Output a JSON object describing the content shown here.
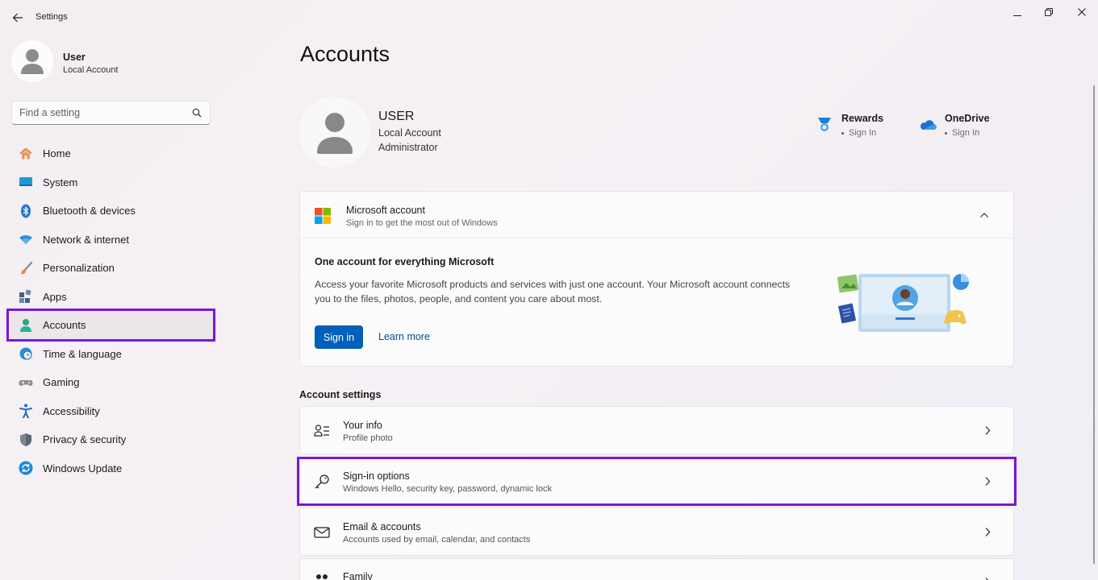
{
  "window": {
    "title": "Settings",
    "icons": {
      "back": "back-arrow-icon",
      "minimize": "minimize-icon",
      "maximize": "restore-icon",
      "close": "close-icon"
    }
  },
  "sidebar": {
    "user": {
      "name": "User",
      "type": "Local Account"
    },
    "search": {
      "placeholder": "Find a setting"
    },
    "items": [
      {
        "label": "Home",
        "icon": "home-icon"
      },
      {
        "label": "System",
        "icon": "system-icon"
      },
      {
        "label": "Bluetooth & devices",
        "icon": "bluetooth-icon"
      },
      {
        "label": "Network & internet",
        "icon": "wifi-icon"
      },
      {
        "label": "Personalization",
        "icon": "brush-icon"
      },
      {
        "label": "Apps",
        "icon": "apps-icon"
      },
      {
        "label": "Accounts",
        "icon": "accounts-icon",
        "active": true
      },
      {
        "label": "Time & language",
        "icon": "globe-clock-icon"
      },
      {
        "label": "Gaming",
        "icon": "controller-icon"
      },
      {
        "label": "Accessibility",
        "icon": "accessibility-icon"
      },
      {
        "label": "Privacy & security",
        "icon": "shield-icon"
      },
      {
        "label": "Windows Update",
        "icon": "update-icon"
      }
    ]
  },
  "main": {
    "title": "Accounts",
    "profile": {
      "name": "USER",
      "type": "Local Account",
      "role": "Administrator"
    },
    "services": [
      {
        "name": "Rewards",
        "status": "Sign In",
        "icon": "rewards-medal-icon"
      },
      {
        "name": "OneDrive",
        "status": "Sign In",
        "icon": "onedrive-cloud-icon"
      }
    ],
    "microsoft_account": {
      "title": "Microsoft account",
      "subtitle": "Sign in to get the most out of Windows",
      "body_title": "One account for everything Microsoft",
      "body_text": "Access your favorite Microsoft products and services with just one account. Your Microsoft account connects you to the files, photos, people, and content you care about most.",
      "signin_label": "Sign in",
      "learn_more_label": "Learn more"
    },
    "account_settings": {
      "heading": "Account settings",
      "rows": [
        {
          "title": "Your info",
          "subtitle": "Profile photo",
          "icon": "person-info-icon"
        },
        {
          "title": "Sign-in options",
          "subtitle": "Windows Hello, security key, password, dynamic lock",
          "icon": "key-icon"
        },
        {
          "title": "Email & accounts",
          "subtitle": "Accounts used by email, calendar, and contacts",
          "icon": "mail-icon"
        },
        {
          "title": "Family",
          "subtitle": "",
          "icon": "family-icon"
        }
      ]
    }
  },
  "colors": {
    "accent": "#005fb8",
    "highlight": "#7b16d6",
    "link": "#004e9b"
  }
}
